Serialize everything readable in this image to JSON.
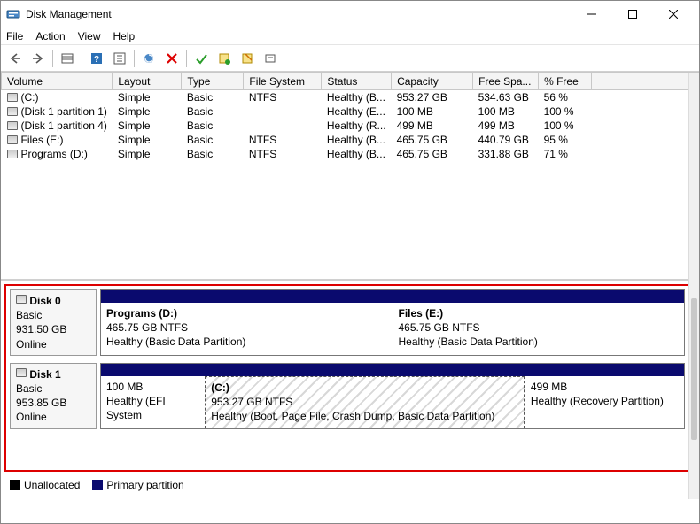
{
  "window": {
    "title": "Disk Management"
  },
  "menu": {
    "file": "File",
    "action": "Action",
    "view": "View",
    "help": "Help"
  },
  "columns": {
    "volume": "Volume",
    "layout": "Layout",
    "type": "Type",
    "fs": "File System",
    "status": "Status",
    "capacity": "Capacity",
    "free": "Free Spa...",
    "pctfree": "% Free"
  },
  "volumes": [
    {
      "name": "(C:)",
      "layout": "Simple",
      "type": "Basic",
      "fs": "NTFS",
      "status": "Healthy (B...",
      "capacity": "953.27 GB",
      "free": "534.63 GB",
      "pct": "56 %"
    },
    {
      "name": "(Disk 1 partition 1)",
      "layout": "Simple",
      "type": "Basic",
      "fs": "",
      "status": "Healthy (E...",
      "capacity": "100 MB",
      "free": "100 MB",
      "pct": "100 %"
    },
    {
      "name": "(Disk 1 partition 4)",
      "layout": "Simple",
      "type": "Basic",
      "fs": "",
      "status": "Healthy (R...",
      "capacity": "499 MB",
      "free": "499 MB",
      "pct": "100 %"
    },
    {
      "name": "Files (E:)",
      "layout": "Simple",
      "type": "Basic",
      "fs": "NTFS",
      "status": "Healthy (B...",
      "capacity": "465.75 GB",
      "free": "440.79 GB",
      "pct": "95 %"
    },
    {
      "name": "Programs  (D:)",
      "layout": "Simple",
      "type": "Basic",
      "fs": "NTFS",
      "status": "Healthy (B...",
      "capacity": "465.75 GB",
      "free": "331.88 GB",
      "pct": "71 %"
    }
  ],
  "disks": [
    {
      "label": "Disk 0",
      "kind": "Basic",
      "size": "931.50 GB",
      "state": "Online",
      "parts": [
        {
          "title": "Programs   (D:)",
          "line2": "465.75 GB NTFS",
          "line3": "Healthy (Basic Data Partition)",
          "grow": 1,
          "hatched": false
        },
        {
          "title": "Files  (E:)",
          "line2": "465.75 GB NTFS",
          "line3": "Healthy (Basic Data Partition)",
          "grow": 1,
          "hatched": false
        }
      ]
    },
    {
      "label": "Disk 1",
      "kind": "Basic",
      "size": "953.85 GB",
      "state": "Online",
      "parts": [
        {
          "title": "",
          "line2": "100 MB",
          "line3": "Healthy (EFI System",
          "grow": 0.17,
          "hatched": false
        },
        {
          "title": "(C:)",
          "line2": "953.27 GB NTFS",
          "line3": "Healthy (Boot, Page File, Crash Dump, Basic Data Partition)",
          "grow": 0.56,
          "hatched": true
        },
        {
          "title": "",
          "line2": "499 MB",
          "line3": "Healthy (Recovery Partition)",
          "grow": 0.27,
          "hatched": false
        }
      ]
    }
  ],
  "legend": {
    "unallocated": "Unallocated",
    "primary": "Primary partition"
  }
}
